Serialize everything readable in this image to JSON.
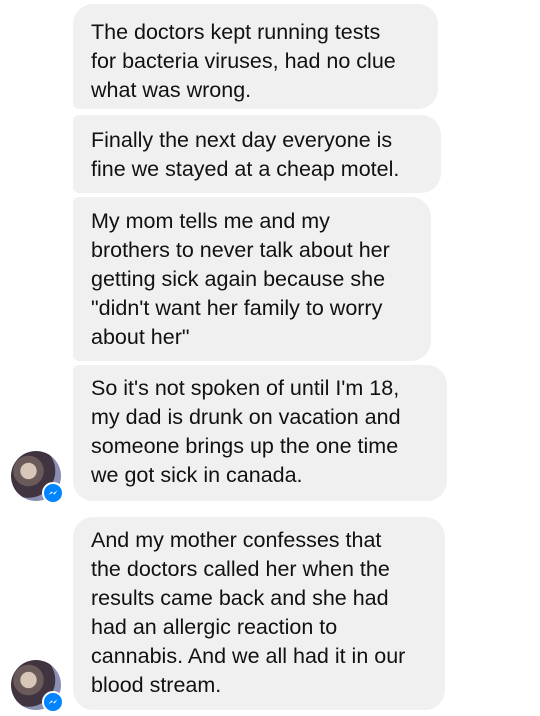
{
  "messages": [
    {
      "text": "The doctors kept running tests\nfor bacteria viruses, had no clue\nwhat was wrong."
    },
    {
      "text": "Finally the next day everyone is\nfine we stayed at a cheap motel."
    },
    {
      "text": "My mom tells me and my\nbrothers to never talk about her\ngetting sick again because she\n\"didn't want her family to worry\nabout her\""
    },
    {
      "text": "So it's not spoken of until I'm 18,\nmy dad is drunk on vacation and\nsomeone brings up the one time\nwe got sick in canada."
    },
    {
      "text": "And my mother confesses that\nthe doctors called her when the\nresults came back and she had\nhad an allergic reaction to\ncannabis. And we all had it in our\nblood stream."
    }
  ],
  "avatar": {
    "icon": "user-avatar",
    "badge_icon": "messenger-badge-icon",
    "badge_color": "#0084ff"
  },
  "colors": {
    "bubble": "#f1f0f0",
    "text": "#111111",
    "background": "#ffffff"
  }
}
